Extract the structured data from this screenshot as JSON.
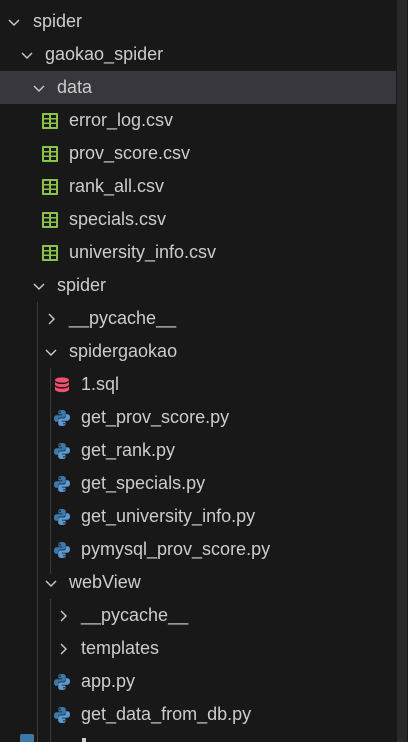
{
  "explorer": {
    "root": {
      "label": "spider",
      "expanded": true
    },
    "gaokao_spider": {
      "label": "gaokao_spider",
      "expanded": true
    },
    "data_folder": {
      "label": "data",
      "expanded": true,
      "selected": true,
      "files": [
        {
          "label": "error_log.csv",
          "icon": "csv-table-icon"
        },
        {
          "label": "prov_score.csv",
          "icon": "csv-table-icon"
        },
        {
          "label": "rank_all.csv",
          "icon": "csv-table-icon"
        },
        {
          "label": "specials.csv",
          "icon": "csv-table-icon"
        },
        {
          "label": "university_info.csv",
          "icon": "csv-table-icon"
        }
      ]
    },
    "spider_folder": {
      "label": "spider",
      "expanded": true
    },
    "pycache_1": {
      "label": "__pycache__",
      "expanded": false
    },
    "spidergaokao": {
      "label": "spidergaokao",
      "expanded": true,
      "files": [
        {
          "label": "1.sql",
          "icon": "database-icon"
        },
        {
          "label": "get_prov_score.py",
          "icon": "python-icon"
        },
        {
          "label": "get_rank.py",
          "icon": "python-icon"
        },
        {
          "label": "get_specials.py",
          "icon": "python-icon"
        },
        {
          "label": "get_university_info.py",
          "icon": "python-icon"
        },
        {
          "label": "pymysql_prov_score.py",
          "icon": "python-icon"
        }
      ]
    },
    "webview": {
      "label": "webView",
      "expanded": true
    },
    "pycache_2": {
      "label": "__pycache__",
      "expanded": false
    },
    "templates": {
      "label": "templates",
      "expanded": false
    },
    "webview_files": [
      {
        "label": "app.py",
        "icon": "python-icon"
      },
      {
        "label": "get_data_from_db.py",
        "icon": "python-icon"
      }
    ]
  },
  "colors": {
    "background": "#181818",
    "selected_row": "#37373d",
    "text": "#cccccc",
    "csv_icon": "#8bc34a",
    "sql_icon": "#f0506e",
    "python_blue": "#3c78aa",
    "python_yellow": "#ffd43b"
  }
}
